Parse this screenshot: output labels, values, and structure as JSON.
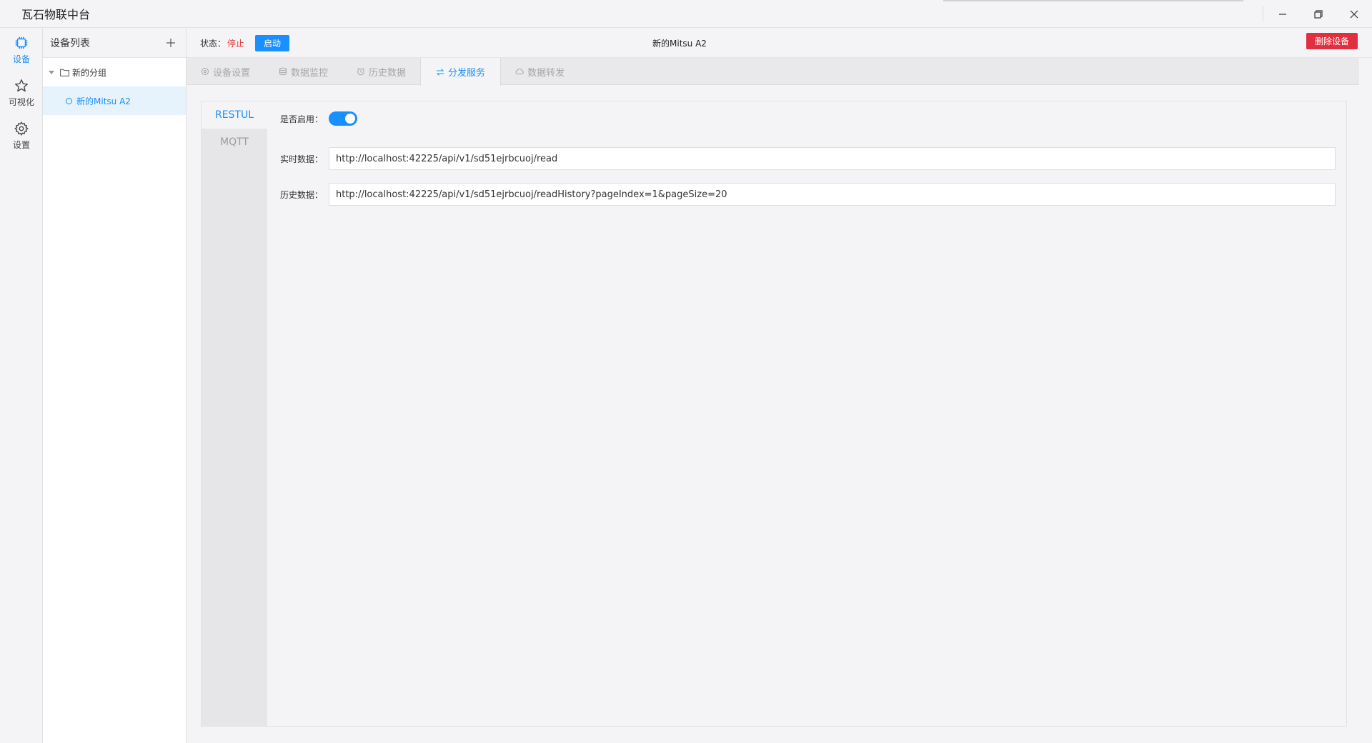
{
  "app": {
    "title": "瓦石物联中台"
  },
  "rail": {
    "items": [
      {
        "label": "设备",
        "icon": "chip-icon",
        "active": true
      },
      {
        "label": "可视化",
        "icon": "star-icon",
        "active": false
      },
      {
        "label": "设置",
        "icon": "gear-icon",
        "active": false
      }
    ]
  },
  "device_list": {
    "title": "设备列表",
    "group": "新的分组",
    "device": "新的Mitsu A2"
  },
  "toolbar": {
    "status_label": "状态：",
    "status_value": "停止",
    "start_label": "启动",
    "device_title": "新的Mitsu A2",
    "delete_label": "删除设备"
  },
  "tabs": [
    {
      "label": "设备设置",
      "icon": "gear-icon",
      "active": false
    },
    {
      "label": "数据监控",
      "icon": "database-icon",
      "active": false
    },
    {
      "label": "历史数据",
      "icon": "clock-icon",
      "active": false
    },
    {
      "label": "分发服务",
      "icon": "exchange-icon",
      "active": true
    },
    {
      "label": "数据转发",
      "icon": "cloud-icon",
      "active": false
    }
  ],
  "subtabs": [
    {
      "label": "RESTUL",
      "active": true
    },
    {
      "label": "MQTT",
      "active": false
    }
  ],
  "form": {
    "enable_label": "是否启用：",
    "enabled": true,
    "realtime_label": "实时数据：",
    "realtime_url": "http://localhost:42225/api/v1/sd51ejrbcuoj/read",
    "history_label": "历史数据：",
    "history_url": "http://localhost:42225/api/v1/sd51ejrbcuoj/readHistory?pageIndex=1&pageSize=20"
  },
  "colors": {
    "accent": "#1890ff",
    "danger": "#e0303f",
    "status_stopped": "#e53935"
  }
}
